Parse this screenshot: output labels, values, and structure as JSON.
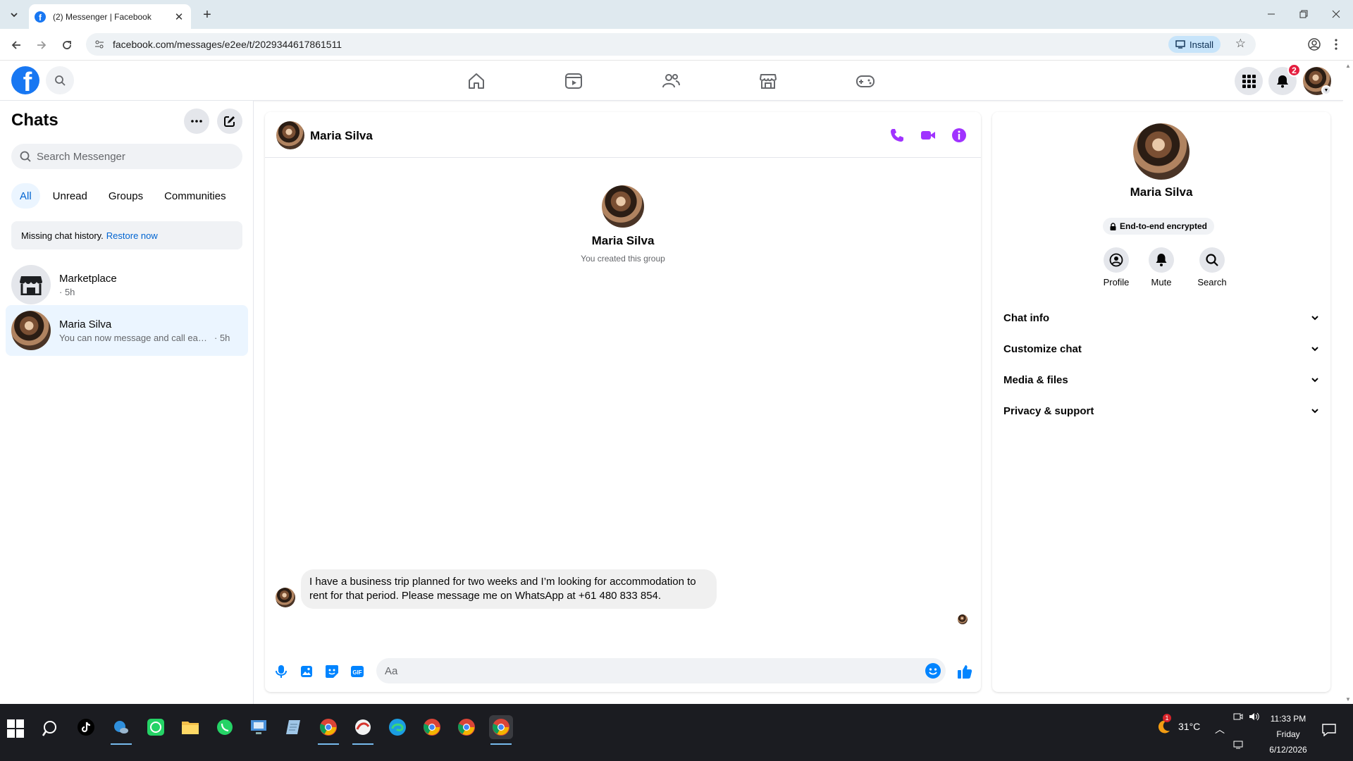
{
  "browser": {
    "tab_title": "(2) Messenger | Facebook",
    "url": "facebook.com/messages/e2ee/t/2029344617861511",
    "install_label": "Install"
  },
  "fb_nav": {
    "notifications_count": "2"
  },
  "chats": {
    "title": "Chats",
    "search_placeholder": "Search Messenger",
    "filters": [
      "All",
      "Unread",
      "Groups",
      "Communities"
    ],
    "active_filter": "All",
    "history_banner": {
      "text": "Missing chat history.",
      "link": "Restore now"
    },
    "items": [
      {
        "name": "Marketplace",
        "preview": "",
        "time": "· 5h",
        "selected": false
      },
      {
        "name": "Maria Silva",
        "preview": "You can now message and call each o...",
        "time": "· 5h",
        "selected": true
      }
    ]
  },
  "conversation": {
    "header_name": "Maria Silva",
    "intro_name": "Maria Silva",
    "intro_subtitle": "You created this group",
    "messages": [
      {
        "from": "Maria Silva",
        "text": "I have a business trip planned for two weeks and I’m looking for accommodation to rent for that period. Please message me on WhatsApp at +61 480 833 854."
      }
    ],
    "composer_placeholder": "Aa",
    "accent_color": "#a033ff",
    "like_color": "#0084ff"
  },
  "info": {
    "name": "Maria Silva",
    "encryption_badge": "End-to-end encrypted",
    "actions": [
      {
        "label": "Profile",
        "icon": "profile-icon"
      },
      {
        "label": "Mute",
        "icon": "bell-icon"
      },
      {
        "label": "Search",
        "icon": "search-icon"
      }
    ],
    "sections": [
      "Chat info",
      "Customize chat",
      "Media & files",
      "Privacy & support"
    ]
  },
  "taskbar": {
    "temperature": "31°C",
    "time": "11:33 PM",
    "day": "Friday",
    "date": "6/12/2026",
    "weather_alert": "1"
  }
}
